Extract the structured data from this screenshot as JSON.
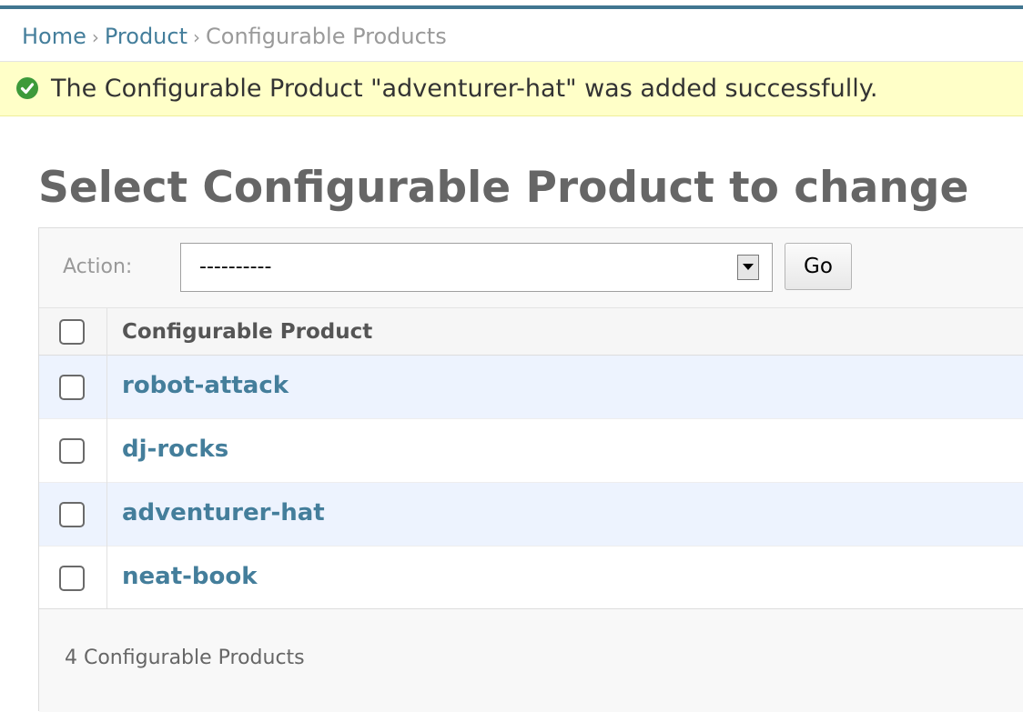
{
  "breadcrumbs": {
    "home": "Home",
    "section": "Product",
    "current": "Configurable Products",
    "separator": "›"
  },
  "message": {
    "icon": "success-check-icon",
    "text": "The Configurable Product \"adventurer-hat\" was added successfully."
  },
  "page_title": "Select Configurable Product to change",
  "actions": {
    "label": "Action:",
    "selected_option": "----------",
    "go_label": "Go"
  },
  "table": {
    "column_header": "Configurable Product",
    "rows": [
      {
        "name": "robot-attack"
      },
      {
        "name": "dj-rocks"
      },
      {
        "name": "adventurer-hat"
      },
      {
        "name": "neat-book"
      }
    ]
  },
  "paginator": {
    "count_text": "4 Configurable Products"
  },
  "colors": {
    "link": "#447e9b",
    "header_border": "#417690",
    "message_bg": "#ffffc8",
    "success_icon": "#3d9a3a",
    "row_alt_bg": "#edf3fe"
  }
}
